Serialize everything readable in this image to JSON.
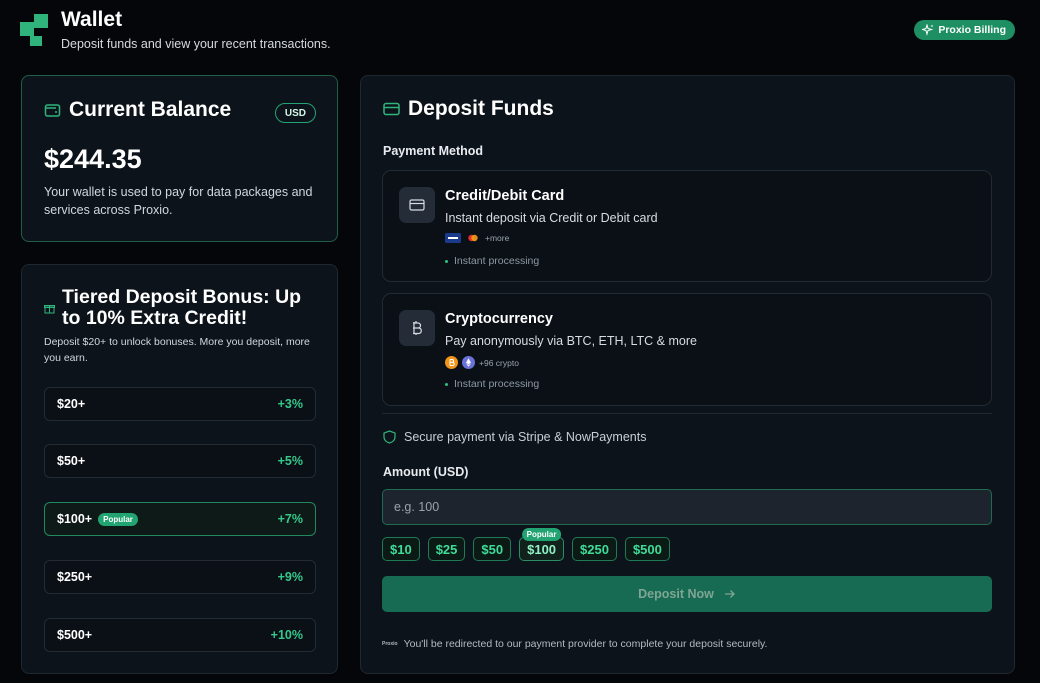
{
  "header": {
    "title": "Wallet",
    "subtitle": "Deposit funds and view your recent transactions.",
    "badge": "Proxio Billing",
    "brand_color": "#2fb47c"
  },
  "balance": {
    "title": "Current Balance",
    "currency": "USD",
    "amount": "$244.35",
    "description": "Your wallet is used to pay for data packages and services across Proxio."
  },
  "bonus": {
    "title": "Tiered Deposit Bonus: Up to 10% Extra Credit!",
    "description": "Deposit $20+ to unlock bonuses. More you deposit, more you earn.",
    "popular_label": "Popular",
    "tiers": [
      {
        "amount": "$20+",
        "bonus": "+3%"
      },
      {
        "amount": "$50+",
        "bonus": "+5%"
      },
      {
        "amount": "$100+",
        "bonus": "+7%"
      },
      {
        "amount": "$250+",
        "bonus": "+9%"
      },
      {
        "amount": "$500+",
        "bonus": "+10%"
      }
    ]
  },
  "deposit": {
    "title": "Deposit Funds",
    "payment_method_label": "Payment Method",
    "methods": [
      {
        "title": "Credit/Debit Card",
        "description": "Instant deposit via Credit or Debit card",
        "extra": "+more",
        "processing": "Instant processing",
        "icon": "credit-card-icon"
      },
      {
        "title": "Cryptocurrency",
        "description": "Pay anonymously via BTC, ETH, LTC & more",
        "extra": "+96 crypto",
        "processing": "Instant processing",
        "icon": "bitcoin-icon"
      }
    ],
    "secure_text": "Secure payment via Stripe & NowPayments",
    "amount_label": "Amount (USD)",
    "amount_placeholder": "e.g. 100",
    "presets": [
      "$10",
      "$25",
      "$50",
      "$100",
      "$250",
      "$500"
    ],
    "preset_popular_label": "Popular",
    "button_label": "Deposit Now",
    "redirect_brand": "Proxio",
    "redirect_text": "You'll be redirected to our payment provider to complete your deposit securely."
  }
}
